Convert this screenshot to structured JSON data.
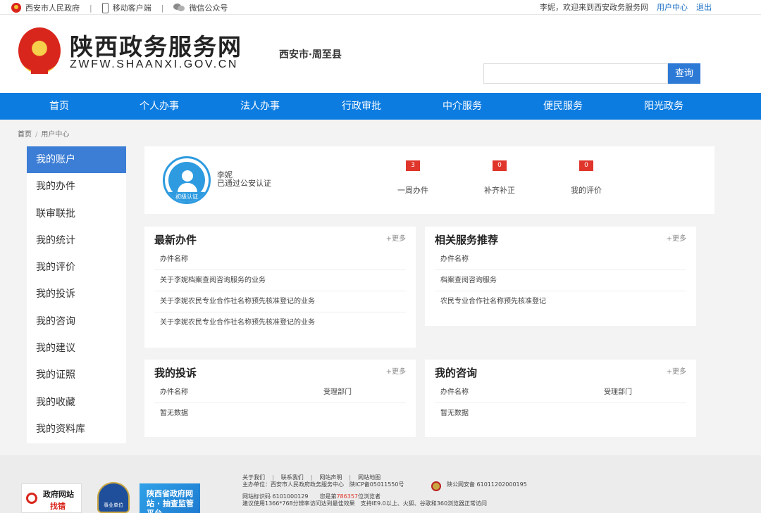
{
  "topbar": {
    "gov_link": "西安市人民政府",
    "mobile_link": "移动客户端",
    "wechat_link": "微信公众号",
    "welcome": "李妮，欢迎来到西安政务服务网",
    "user_center": "用户中心",
    "logout": "退出"
  },
  "header": {
    "site_title": "陕西政务服务网",
    "site_url": "ZWFW.SHAANXI.GOV.CN",
    "region": "西安市·周至县",
    "search_placeholder": "",
    "search_button": "查询"
  },
  "nav": {
    "items": [
      "首页",
      "个人办事",
      "法人办事",
      "行政审批",
      "中介服务",
      "便民服务",
      "阳光政务"
    ]
  },
  "breadcrumb": {
    "home": "首页",
    "current": "用户中心"
  },
  "sidebar": {
    "items": [
      "我的账户",
      "我的办件",
      "联审联批",
      "我的统计",
      "我的评价",
      "我的投诉",
      "我的咨询",
      "我的建议",
      "我的证照",
      "我的收藏",
      "我的资料库"
    ],
    "active": "我的账户"
  },
  "account": {
    "avatar_badge": "初级认证",
    "name": "李妮",
    "status": "已通过公安认证",
    "stats": [
      {
        "count": "3",
        "label": "一周办件"
      },
      {
        "count": "0",
        "label": "补齐补正"
      },
      {
        "count": "0",
        "label": "我的评价"
      }
    ]
  },
  "latest_cases": {
    "title": "最新办件",
    "more": "+更多",
    "header": "办件名称",
    "rows": [
      "关于李妮档案查阅咨询服务的业务",
      "关于李妮农民专业合作社名称预先核准登记的业务",
      "关于李妮农民专业合作社名称预先核准登记的业务"
    ]
  },
  "recommend": {
    "title": "相关服务推荐",
    "more": "+更多",
    "header": "办件名称",
    "rows": [
      "档案查阅咨询服务",
      "农民专业合作社名称预先核准登记"
    ]
  },
  "complaints": {
    "title": "我的投诉",
    "more": "+更多",
    "col1": "办件名称",
    "col2": "受理部门",
    "empty": "暂无数据"
  },
  "consults": {
    "title": "我的咨询",
    "more": "+更多",
    "col1": "办件名称",
    "col2": "受理部门",
    "empty": "暂无数据"
  },
  "footer": {
    "links": [
      "关于我们",
      "联系我们",
      "网站声明",
      "网站地图"
    ],
    "host": "主办单位：西安市人民政府政务服务中心",
    "icp": "陕ICP备05011550号",
    "police": "陕公网安备 61011202000195",
    "site_id": "网站标识码 6101000129",
    "visits_prefix": "您是第",
    "visits": "786357",
    "visits_suffix": "位浏览者",
    "browser_tip": "建议使用1366*768分辨率访问达到最佳效果　支持IE9.0以上、火狐、谷歌和360浏览器正常访问",
    "logo1_line1": "政府网站",
    "logo1_line2": "找错",
    "logo2_text": "事业单位",
    "logo3_text": "陕西省政府网站 · 抽查监管平台"
  },
  "colors": {
    "nav_blue": "#0c7ce0",
    "active_blue": "#3c7dd5",
    "badge_red": "#e0352b"
  }
}
